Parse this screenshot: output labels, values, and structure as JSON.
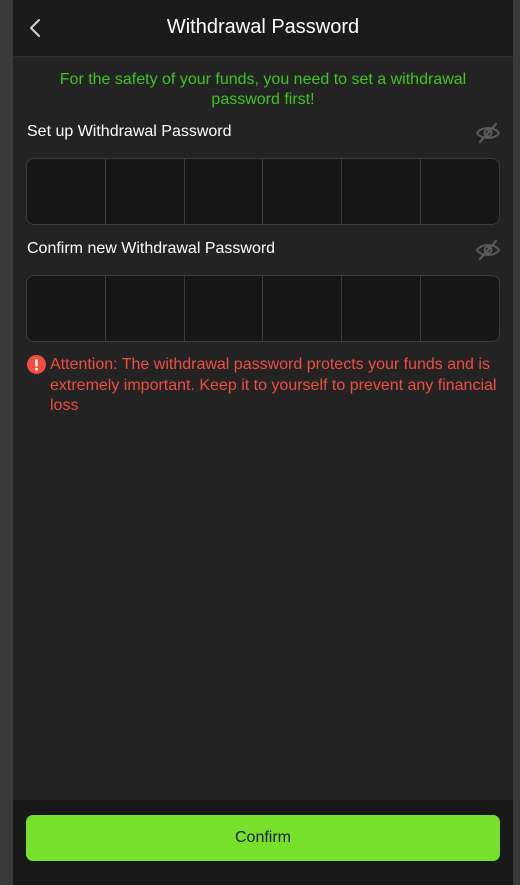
{
  "header": {
    "title": "Withdrawal Password",
    "back_icon": "chevron-left-icon"
  },
  "notice": "For the safety of your funds, you need to set a withdrawal password first!",
  "setup": {
    "label": "Set up Withdrawal Password",
    "toggle_icon": "eye-off-icon",
    "digits": [
      "",
      "",
      "",
      "",
      "",
      ""
    ]
  },
  "confirm_field": {
    "label": "Confirm new Withdrawal Password",
    "toggle_icon": "eye-off-icon",
    "digits": [
      "",
      "",
      "",
      "",
      "",
      ""
    ]
  },
  "attention": {
    "icon": "exclamation-circle-icon",
    "text": "Attention: The withdrawal password protects your funds and is extremely important. Keep it to yourself to prevent any financial loss"
  },
  "footer": {
    "confirm_label": "Confirm"
  },
  "colors": {
    "accent_green": "#77e02a",
    "notice_green": "#3ec51f",
    "warning_red": "#f14d42",
    "background": "#232323"
  }
}
